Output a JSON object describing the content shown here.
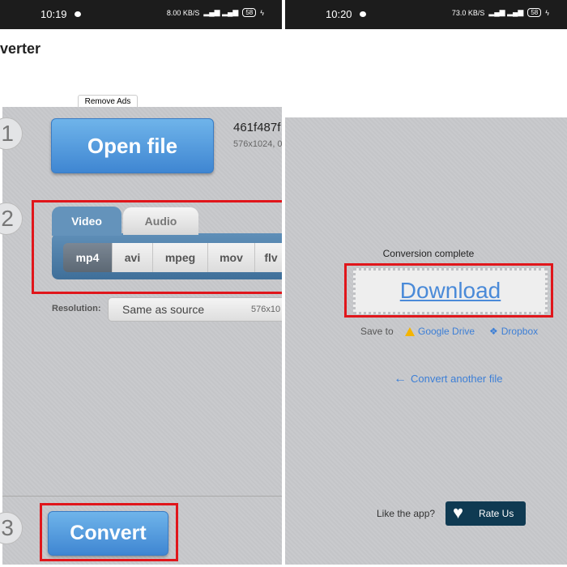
{
  "left": {
    "status": {
      "time": "10:19",
      "speed": "8.00 KB/S",
      "network": "4G",
      "battery": "58"
    },
    "app_title": "verter",
    "remove_ads": "Remove Ads",
    "steps": [
      "1",
      "2",
      "3"
    ],
    "open_file": "Open file",
    "file_name": "461f487f",
    "file_info": "576x1024, 0",
    "tabs": [
      {
        "label": "Video",
        "active": true
      },
      {
        "label": "Audio",
        "active": false
      }
    ],
    "formats": [
      {
        "label": "mp4",
        "selected": true
      },
      {
        "label": "avi"
      },
      {
        "label": "mpeg"
      },
      {
        "label": "mov"
      },
      {
        "label": "flv"
      }
    ],
    "resolution_label": "Resolution:",
    "resolution_value": "Same as source",
    "resolution_size": "576x10",
    "convert": "Convert"
  },
  "right": {
    "status": {
      "time": "10:20",
      "speed": "73.0 KB/S",
      "network": "4G",
      "battery": "58"
    },
    "conversion_complete": "Conversion complete",
    "download": "Download",
    "save_to": "Save to",
    "google_drive": "Google Drive",
    "dropbox": "Dropbox",
    "convert_another": "Convert another file",
    "like_app": "Like the app?",
    "rate_us": "Rate Us"
  },
  "colors": {
    "highlight": "#e0161b",
    "button_blue": "#4a90d9",
    "rate_bg": "#0f3a52",
    "link": "#3d7fd6"
  }
}
